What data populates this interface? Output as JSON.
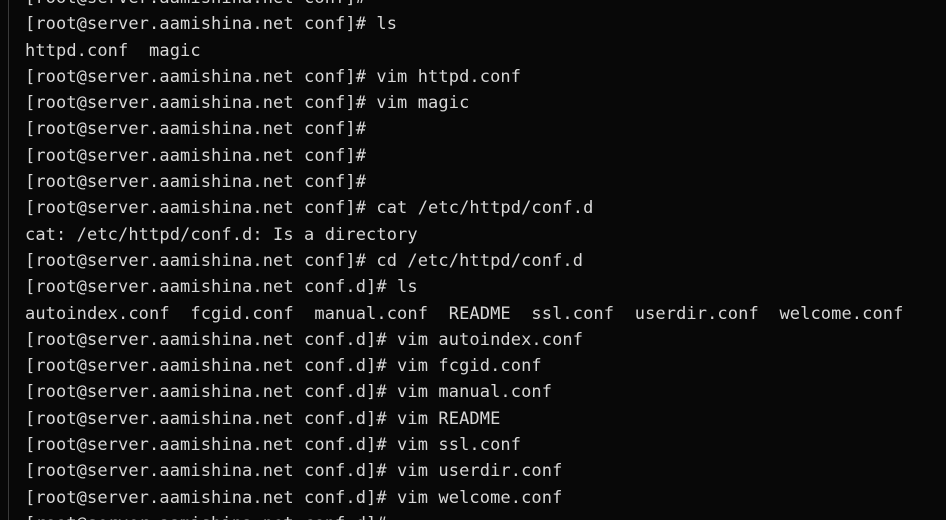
{
  "terminal": {
    "lines": [
      "[root@server.aamishina.net conf]#",
      "[root@server.aamishina.net conf]# ls",
      "httpd.conf  magic",
      "[root@server.aamishina.net conf]# vim httpd.conf",
      "[root@server.aamishina.net conf]# vim magic",
      "[root@server.aamishina.net conf]#",
      "[root@server.aamishina.net conf]#",
      "[root@server.aamishina.net conf]#",
      "[root@server.aamishina.net conf]# cat /etc/httpd/conf.d",
      "cat: /etc/httpd/conf.d: Is a directory",
      "[root@server.aamishina.net conf]# cd /etc/httpd/conf.d",
      "[root@server.aamishina.net conf.d]# ls",
      "autoindex.conf  fcgid.conf  manual.conf  README  ssl.conf  userdir.conf  welcome.conf",
      "[root@server.aamishina.net conf.d]# vim autoindex.conf",
      "[root@server.aamishina.net conf.d]# vim fcgid.conf",
      "[root@server.aamishina.net conf.d]# vim manual.conf",
      "[root@server.aamishina.net conf.d]# vim README",
      "[root@server.aamishina.net conf.d]# vim ssl.conf",
      "[root@server.aamishina.net conf.d]# vim userdir.conf",
      "[root@server.aamishina.net conf.d]# vim welcome.conf",
      "[root@server.aamishina.net conf.d]#"
    ]
  },
  "colors": {
    "background": "#080808",
    "text": "#d8d8d8"
  }
}
